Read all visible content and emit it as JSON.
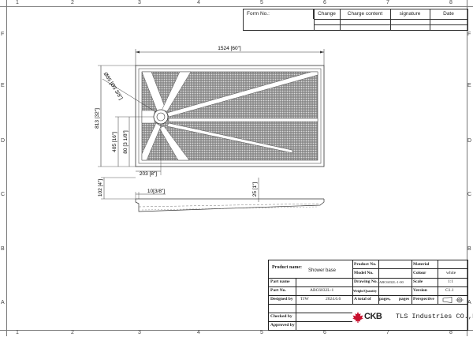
{
  "ruler": {
    "top": [
      "1",
      "2",
      "3",
      "4",
      "5",
      "6",
      "7",
      "8"
    ],
    "left": [
      "F",
      "E",
      "D",
      "C",
      "B",
      "A"
    ]
  },
  "form_header": {
    "form_no": "Form No.:",
    "change": "Change",
    "charge_content": "Charge content",
    "signature": "signature",
    "date": "Date"
  },
  "drawing": {
    "dim_width": "1524 [60\"]",
    "dim_height": "813 [32\"]",
    "dim_drain_dia": "Ø85 [Ø3 3/8\"]",
    "dim_drain_y1": "405 [16\"]",
    "dim_drain_y2": "80 [3 1/8\"]",
    "dim_drain_x": "203 [8\"]",
    "dim_side_height": "102 [4\"]",
    "dim_lip": "10[3/8\"]",
    "dim_flange": "25 [1\"]"
  },
  "title_block": {
    "product_name_label": "Product name:",
    "product_name": "Shower base",
    "product_no_label": "Product No.",
    "model_no_label": "Model No.",
    "material_label": "Material",
    "colour_label": "Colour",
    "colour": "white",
    "part_name_label": "Part name",
    "drawing_no_label": "Drawing No.",
    "drawing_no": "ABC6032L-1-00",
    "scale_label": "Scale",
    "scale": "1:1",
    "part_no_label": "Part No.",
    "part_no": "ABC6032L-1",
    "weight_label": "Weight/Quantity",
    "version_label": "Version",
    "version": "C1.1",
    "designed_label": "Designed by",
    "designer": "TJW",
    "date": "2024.6.6",
    "total_label": "A total of",
    "pages_label": "pages,",
    "pages2_label": "pages",
    "perspective_label": "Perspective",
    "checked_label": "Checked by",
    "approved_label": "Approved by",
    "company": "TLS Industries CO.,Ltd",
    "logo_text": "CKB"
  }
}
